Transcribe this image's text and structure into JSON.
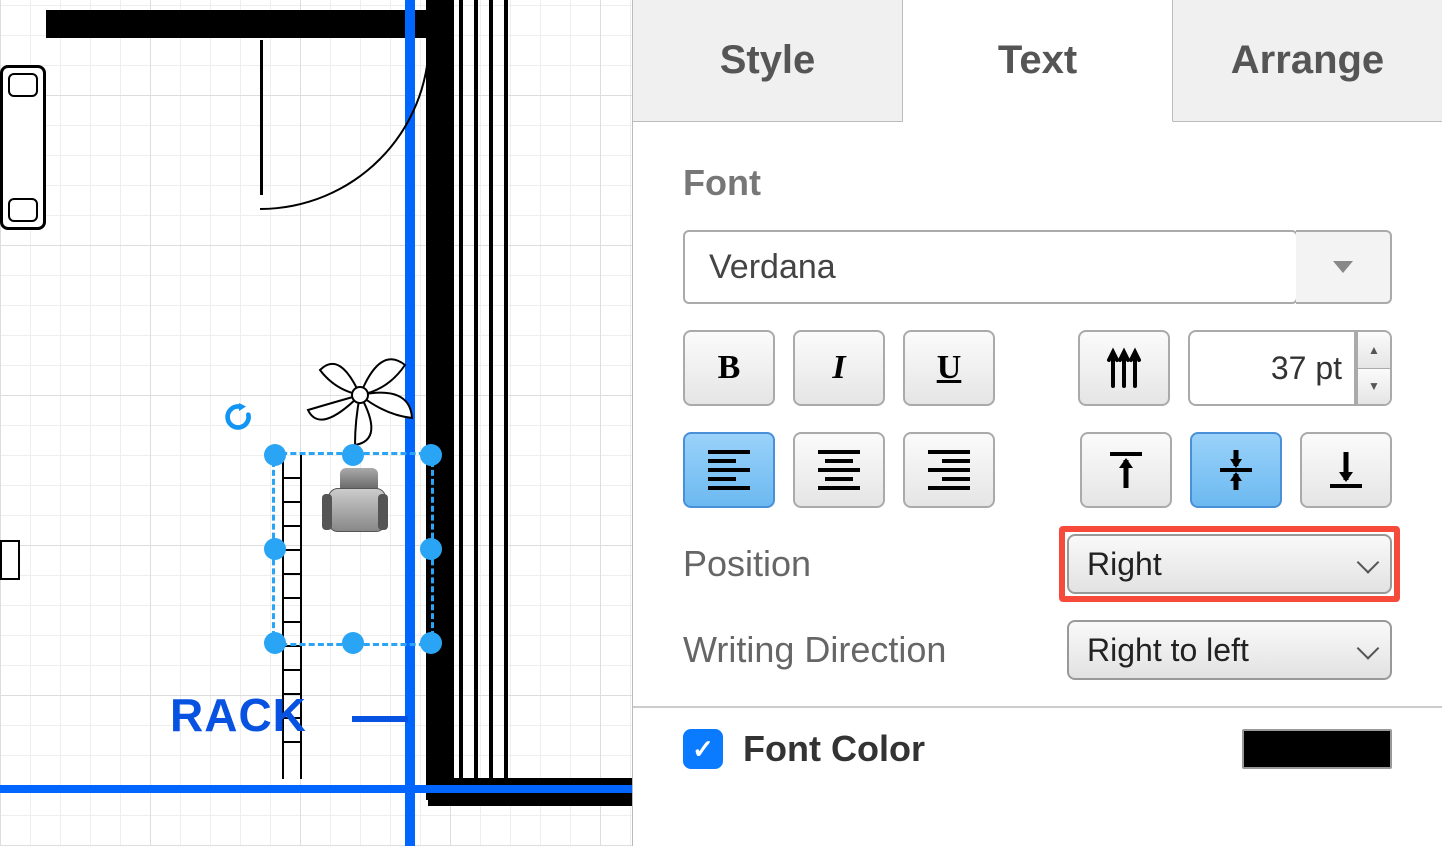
{
  "tabs": {
    "style": "Style",
    "text": "Text",
    "arrange": "Arrange",
    "active": "text"
  },
  "font": {
    "section_label": "Font",
    "family": "Verdana",
    "size": "37 pt",
    "bold_label": "B",
    "italic_label": "I",
    "underline_label": "U",
    "position_label": "Position",
    "position_value": "Right",
    "writing_label": "Writing Direction",
    "writing_value": "Right to left"
  },
  "font_color": {
    "label": "Font Color",
    "checked": true,
    "value": "#000000"
  },
  "canvas": {
    "selected_label": "RACK"
  }
}
